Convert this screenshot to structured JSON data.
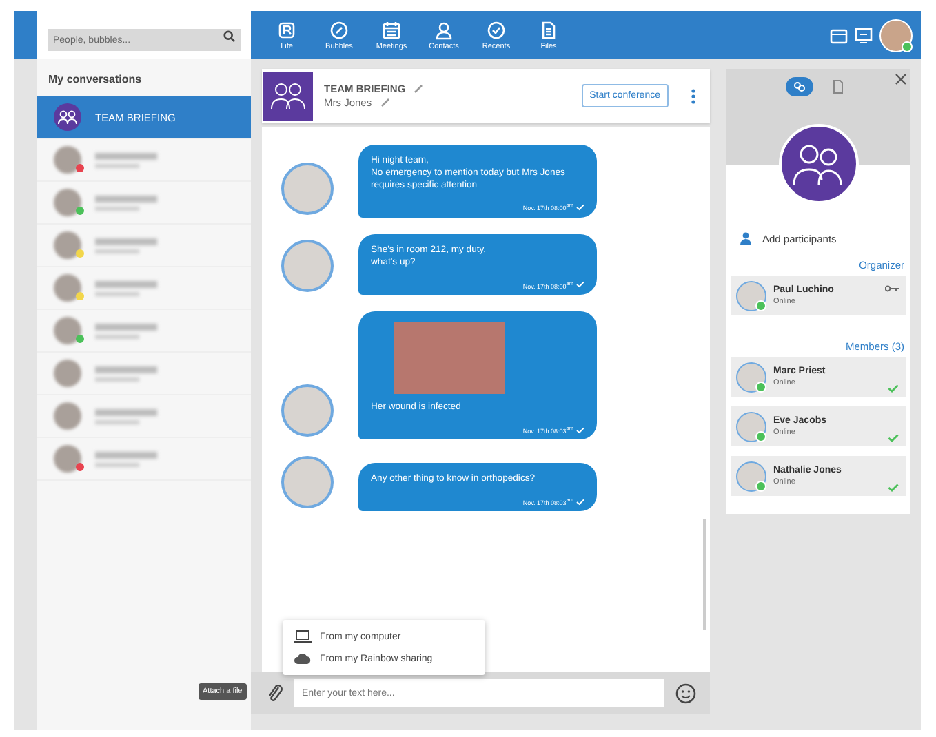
{
  "search": {
    "placeholder": "People, bubbles..."
  },
  "nav": [
    {
      "label": "Life"
    },
    {
      "label": "Bubbles"
    },
    {
      "label": "Meetings"
    },
    {
      "label": "Contacts"
    },
    {
      "label": "Recents"
    },
    {
      "label": "Files"
    }
  ],
  "sidebar": {
    "title": "My conversations",
    "items": [
      {
        "kind": "bubble",
        "label": "TEAM BRIEFING",
        "selected": true
      },
      {
        "kind": "blurred",
        "selected": false,
        "color": "#e8434f"
      },
      {
        "kind": "blurred",
        "selected": false,
        "color": "#4cc15a"
      },
      {
        "kind": "blurred",
        "selected": false,
        "color": "#f2d64b"
      },
      {
        "kind": "blurred",
        "selected": false,
        "color": "#f2d64b"
      },
      {
        "kind": "blurred",
        "selected": false,
        "color": "#4cc15a"
      },
      {
        "kind": "blurred",
        "selected": false
      },
      {
        "kind": "blurred",
        "selected": false
      },
      {
        "kind": "blurred",
        "selected": false,
        "color": "#e8434f"
      }
    ]
  },
  "chat": {
    "title": "TEAM BRIEFING",
    "subtitle": "Mrs Jones",
    "conference_button": "Start conference",
    "messages": [
      {
        "kind": "text",
        "text": "Hi night team,\nNo emergency to mention today but Mrs Jones requires specific attention",
        "time": "Nov. 17th 08:00$^{am}$"
      },
      {
        "kind": "text",
        "text": "She's in room 212, my duty,\nwhat's up?",
        "time": "Nov. 17th 08:00$^{am}$"
      },
      {
        "kind": "image",
        "text": "Her wound is infected",
        "time": "Nov. 17th 08:03$^{am}$"
      },
      {
        "kind": "text",
        "text": "Any other thing to know in orthopedics?",
        "time": "Nov. 17th 08:03$^{am}$"
      }
    ],
    "attach_menu": [
      "From my computer",
      "From my Rainbow sharing"
    ],
    "attach_tooltip": "Attach a file",
    "input": {
      "placeholder": "Enter your text here..."
    }
  },
  "details": {
    "tabs": [
      {
        "selected": true
      },
      {
        "selected": false
      }
    ],
    "add_participants": "Add participants",
    "organizer_title": "Organizer",
    "organizer": {
      "name": "Paul Luchino",
      "status": "Online"
    },
    "members_title": "Members (3)",
    "members": [
      {
        "name": "Marc Priest",
        "status": "Online"
      },
      {
        "name": "Eve Jacobs",
        "status": "Online"
      },
      {
        "name": "Nathalie Jones",
        "status": "Online"
      }
    ]
  }
}
